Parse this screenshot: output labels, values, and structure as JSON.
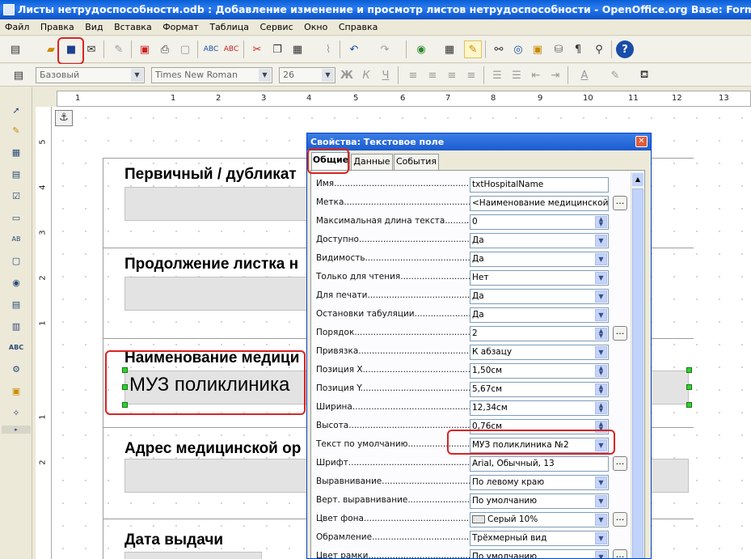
{
  "window": {
    "title": "Листы нетрудоспособности.odb : Добавление изменение и просмотр листов нетрудоспособности - OpenOffice.org Base: Form Design"
  },
  "menu": [
    "Файл",
    "Правка",
    "Вид",
    "Вставка",
    "Формат",
    "Таблица",
    "Сервис",
    "Окно",
    "Справка"
  ],
  "formatting_bar": {
    "style": "Базовый",
    "font": "Times New Roman",
    "size": "26"
  },
  "ruler": {
    "h_numbers": [
      "1",
      "1",
      "2",
      "3",
      "4",
      "5",
      "6",
      "7",
      "8",
      "9",
      "10",
      "11",
      "12",
      "13"
    ],
    "v_numbers": [
      "5",
      "4",
      "3",
      "2",
      "1",
      "1",
      "2"
    ]
  },
  "form": {
    "labels": [
      "Первичный / дубликат",
      "Продолжение листка н",
      "Наименование медици",
      "Адрес медицинской ор",
      "Дата выдачи"
    ],
    "selected_value": "МУЗ поликлиника"
  },
  "dialog": {
    "title": "Свойства: Текстовое поле",
    "close": "✕",
    "tabs": [
      "Общие",
      "Данные",
      "События"
    ],
    "properties": [
      {
        "label": "Имя.........................................................",
        "value": "txtHospitalName",
        "kind": "text",
        "button": false
      },
      {
        "label": "Метка........................................................",
        "value": "<Наименование медицинской орг",
        "kind": "text",
        "button": true
      },
      {
        "label": "Максимальная длина текста..............",
        "value": "0",
        "kind": "spin",
        "button": false
      },
      {
        "label": "Доступно.....................................................",
        "value": "Да",
        "kind": "dd",
        "button": false
      },
      {
        "label": "Видимость....................................................",
        "value": "Да",
        "kind": "dd",
        "button": false
      },
      {
        "label": "Только для чтения..........................",
        "value": "Нет",
        "kind": "dd",
        "button": false
      },
      {
        "label": "Для печати...................................................",
        "value": "Да",
        "kind": "dd",
        "button": false
      },
      {
        "label": "Остановки табуляции..................................",
        "value": "Да",
        "kind": "dd",
        "button": false
      },
      {
        "label": "Порядок......................................................",
        "value": "2",
        "kind": "spin",
        "button": true
      },
      {
        "label": "Привязка.....................................................",
        "value": "К абзацу",
        "kind": "dd",
        "button": false
      },
      {
        "label": "Позиция X....................................................",
        "value": "1,50см",
        "kind": "spin",
        "button": false
      },
      {
        "label": "Позиция Y....................................................",
        "value": "5,67см",
        "kind": "spin",
        "button": false
      },
      {
        "label": "Ширина.......................................................",
        "value": "12,34см",
        "kind": "spin",
        "button": false
      },
      {
        "label": "Высота.......................................................",
        "value": "0,76см",
        "kind": "spin",
        "button": false
      },
      {
        "label": "Текст по умолчанию..............................",
        "value": "МУЗ поликлиника №2",
        "kind": "dd",
        "button": false
      },
      {
        "label": "Шрифт........................................................",
        "value": "Arial, Обычный, 13",
        "kind": "text",
        "button": true
      },
      {
        "label": "Выравнивание.............................................",
        "value": "По левому краю",
        "kind": "dd",
        "button": false
      },
      {
        "label": "Верт. выравнивание..................................",
        "value": "По умолчанию",
        "kind": "dd",
        "button": false
      },
      {
        "label": "Цвет фона...................................................",
        "value": "Серый 10%",
        "kind": "dd",
        "button": true,
        "swatch": true
      },
      {
        "label": "Обрамление..................................................",
        "value": "Трёхмерный вид",
        "kind": "dd",
        "button": false
      },
      {
        "label": "Цвет рамки..................................................",
        "value": "По умолчанию",
        "kind": "dd",
        "button": true
      }
    ],
    "dots_label": "..."
  },
  "colors": {
    "titlebar": "#0a5fd6",
    "highlight": "#d82424",
    "handle": "#2fd12f",
    "field": "#e3e3e3"
  }
}
